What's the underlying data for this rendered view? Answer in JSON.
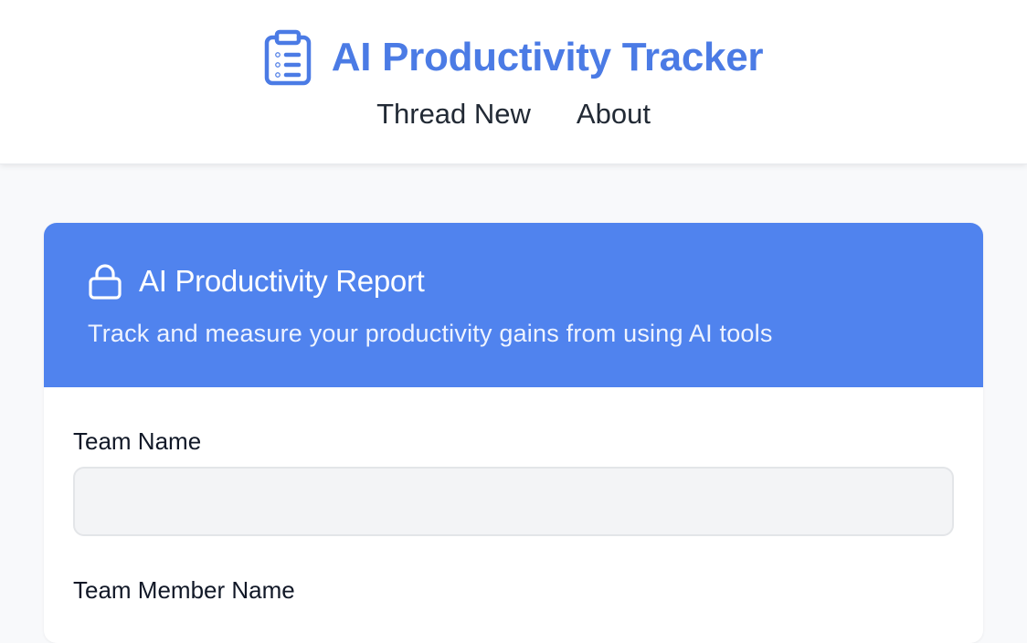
{
  "app": {
    "title": "AI Productivity Tracker",
    "logo_icon": "clipboard-list-icon",
    "brand_color": "#4b7be5"
  },
  "nav": {
    "items": [
      {
        "label": "Thread New"
      },
      {
        "label": "About"
      }
    ]
  },
  "report": {
    "icon": "lock-icon",
    "title": "AI Productivity Report",
    "subtitle": "Track and measure your productivity gains from using AI tools",
    "header_color": "#5083ee"
  },
  "form": {
    "team_name": {
      "label": "Team Name",
      "value": "",
      "placeholder": ""
    },
    "team_member_name": {
      "label": "Team Member Name"
    }
  }
}
